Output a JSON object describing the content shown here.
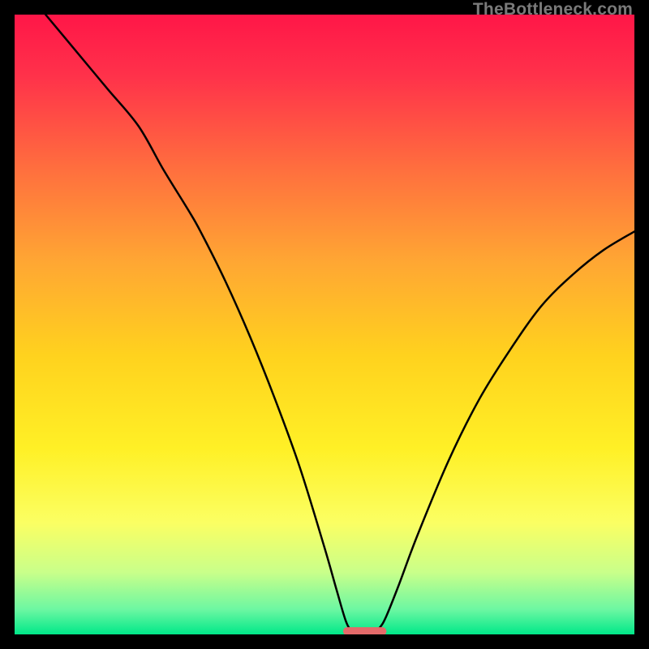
{
  "watermark": "TheBottleneck.com",
  "colors": {
    "gradient_stops": [
      {
        "offset": 0.0,
        "color": "#ff1648"
      },
      {
        "offset": 0.1,
        "color": "#ff324a"
      },
      {
        "offset": 0.25,
        "color": "#ff6f3e"
      },
      {
        "offset": 0.4,
        "color": "#ffa733"
      },
      {
        "offset": 0.55,
        "color": "#ffd21e"
      },
      {
        "offset": 0.7,
        "color": "#fff026"
      },
      {
        "offset": 0.82,
        "color": "#fbff63"
      },
      {
        "offset": 0.9,
        "color": "#c9ff8a"
      },
      {
        "offset": 0.96,
        "color": "#6cf7a2"
      },
      {
        "offset": 1.0,
        "color": "#00e889"
      }
    ],
    "curve": "#000000",
    "marker": "#e46a6a",
    "background": "#000000"
  },
  "chart_data": {
    "type": "line",
    "title": "",
    "xlabel": "",
    "ylabel": "",
    "xlim": [
      0,
      100
    ],
    "ylim": [
      0,
      100
    ],
    "optimal_x": 56,
    "marker": {
      "x_start": 53,
      "x_end": 60,
      "y": 0.5
    },
    "series": [
      {
        "name": "bottleneck-curve",
        "points_xy": [
          [
            5,
            100
          ],
          [
            10,
            94
          ],
          [
            15,
            88
          ],
          [
            20,
            82
          ],
          [
            24,
            75
          ],
          [
            28,
            68.5
          ],
          [
            30,
            65
          ],
          [
            34,
            57
          ],
          [
            38,
            48
          ],
          [
            42,
            38
          ],
          [
            46,
            27
          ],
          [
            50,
            14
          ],
          [
            52,
            7
          ],
          [
            53.5,
            2
          ],
          [
            54.5,
            0.6
          ],
          [
            56,
            0.3
          ],
          [
            58,
            0.5
          ],
          [
            59,
            1.2
          ],
          [
            60,
            3
          ],
          [
            62,
            8
          ],
          [
            65,
            16
          ],
          [
            70,
            28
          ],
          [
            75,
            38
          ],
          [
            80,
            46
          ],
          [
            85,
            53
          ],
          [
            90,
            58
          ],
          [
            95,
            62
          ],
          [
            100,
            65
          ]
        ]
      }
    ]
  }
}
